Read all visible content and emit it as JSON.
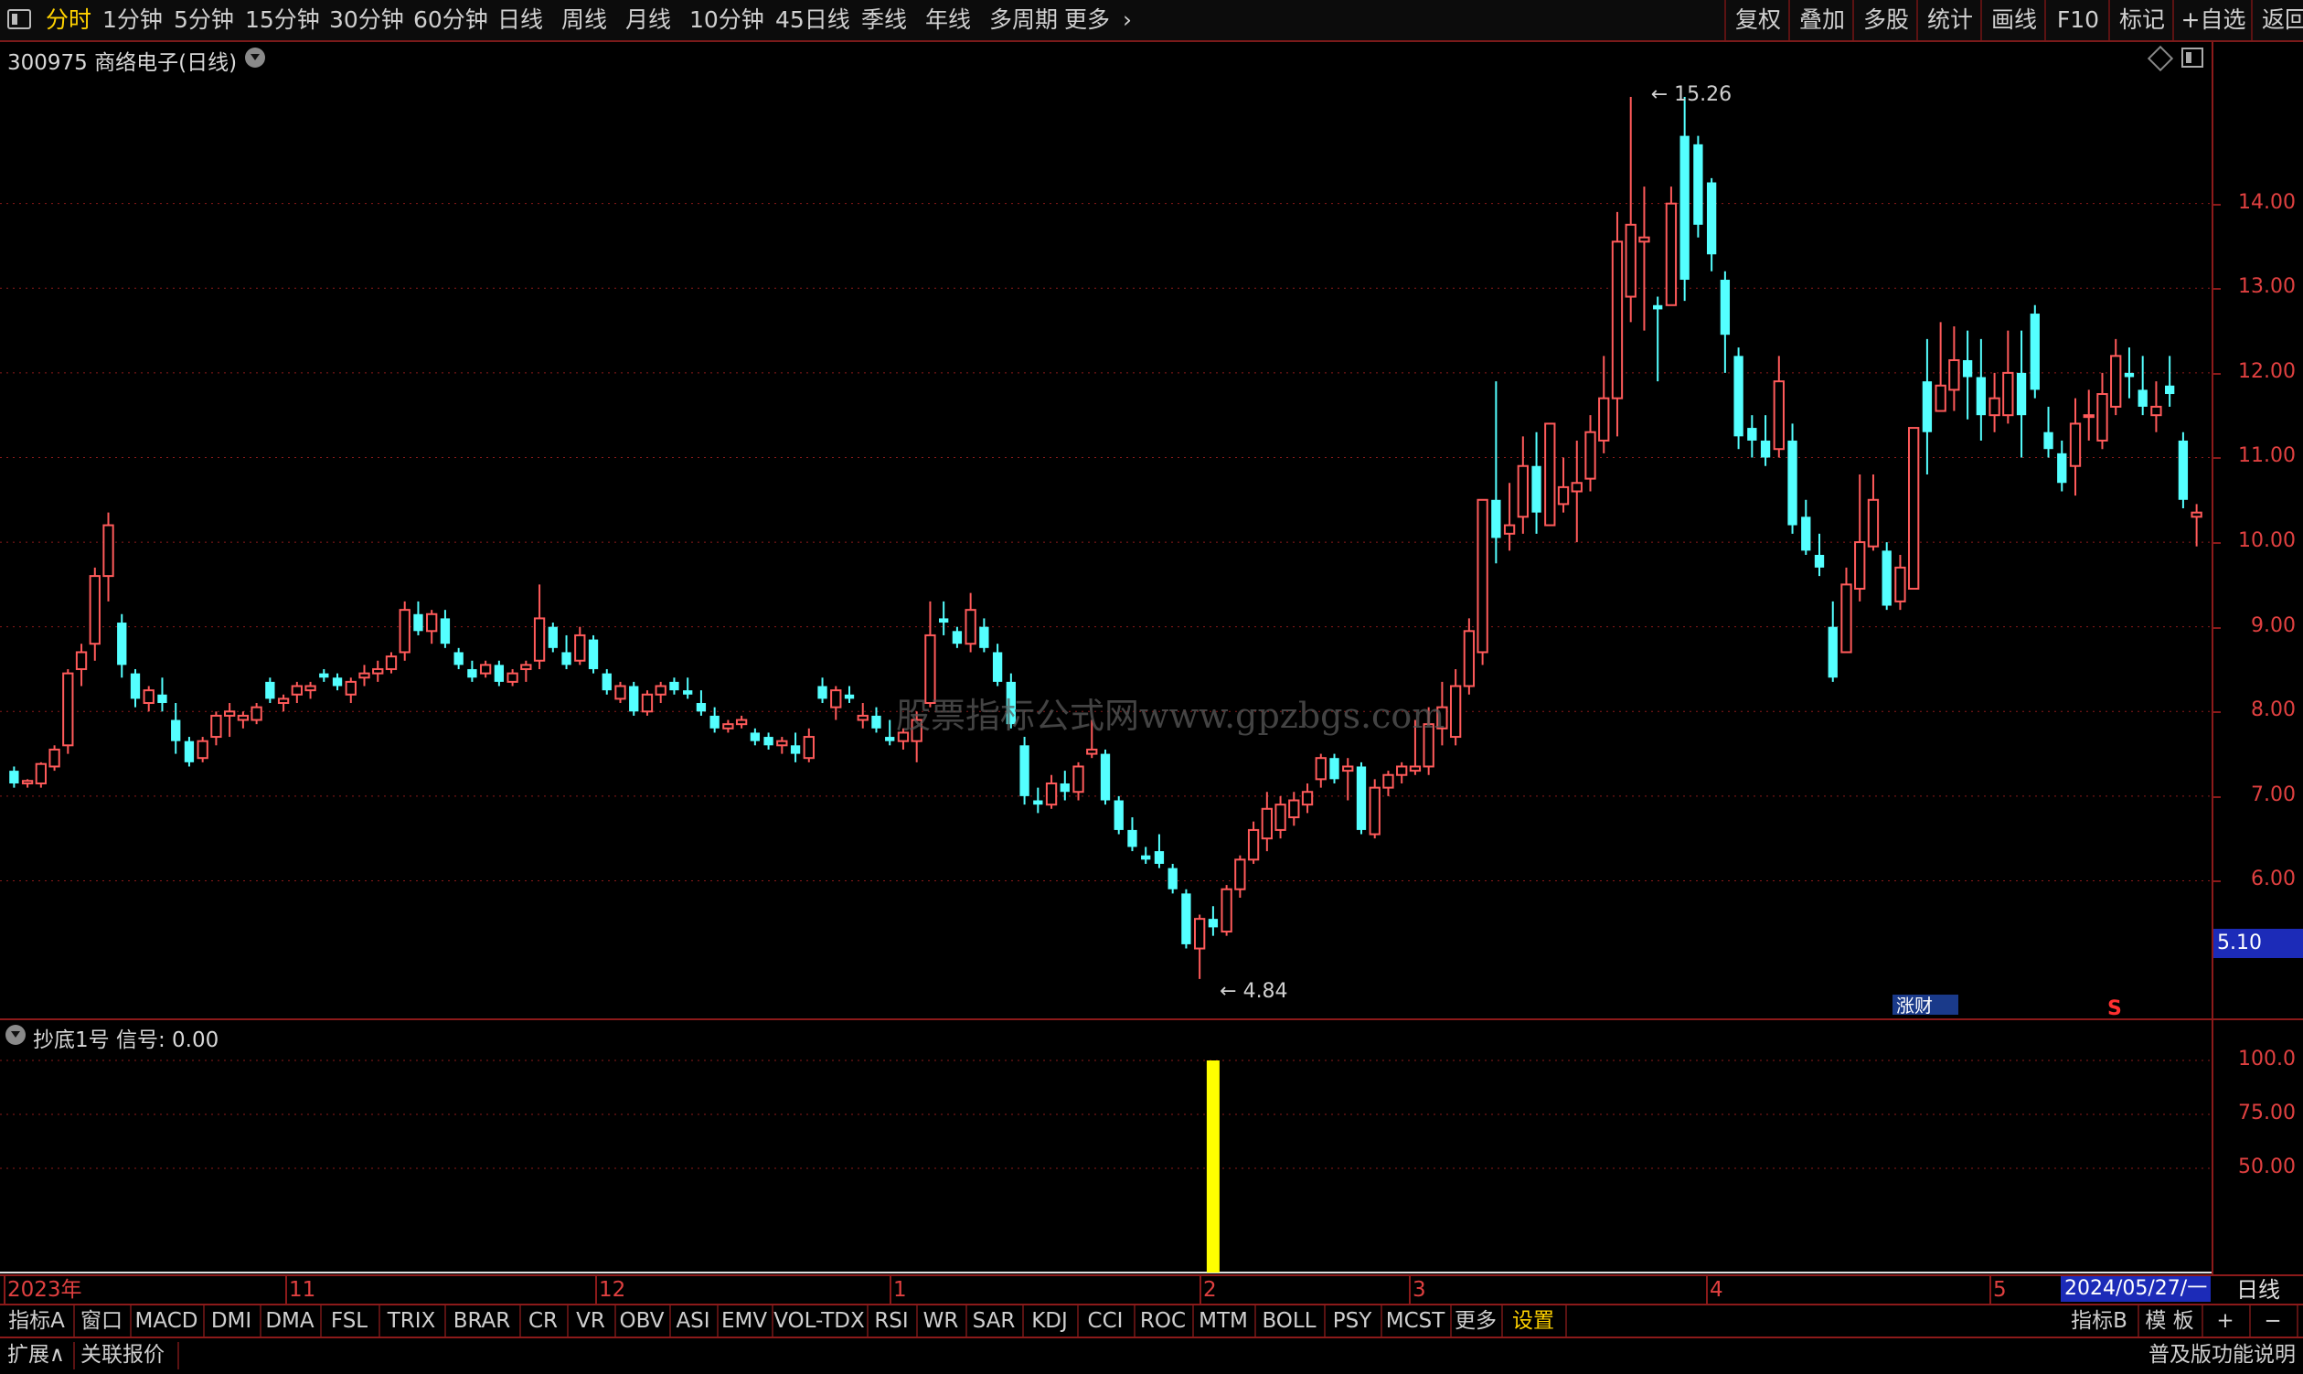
{
  "toolbar": {
    "periods": [
      "分时",
      "1分钟",
      "5分钟",
      "15分钟",
      "30分钟",
      "60分钟",
      "日线",
      "周线",
      "月线",
      "10分钟",
      "45日线",
      "季线",
      "年线",
      "多周期",
      "更多"
    ],
    "active_period": "分时",
    "right_buttons": [
      "复权",
      "叠加",
      "多股",
      "统计",
      "画线",
      "F10",
      "标记",
      "+自选",
      "返回"
    ]
  },
  "main_chart": {
    "title": "300975 商络电子(日线)",
    "high_label": "15.26",
    "low_label": "4.84",
    "last_price": "5.10",
    "y_ticks": [
      "14.00",
      "13.00",
      "12.00",
      "11.00",
      "10.00",
      "9.00",
      "8.00",
      "7.00",
      "6.00"
    ],
    "badge_text": "涨财",
    "s_marker": "S",
    "watermark": "股票指标公式网www.gpzbgs.com",
    "colors": {
      "up": "#ff5a5a",
      "down": "#54ffff",
      "grid": "#8b1a1a",
      "bg": "#000000"
    }
  },
  "indicator": {
    "title": "抄底1号  信号: 0.00",
    "y_ticks": [
      "100.0",
      "75.00",
      "50.00"
    ],
    "signal_color": "#ffff00"
  },
  "date_axis": {
    "labels": [
      "2023年",
      "11",
      "12",
      "1",
      "2",
      "3",
      "4",
      "5"
    ],
    "current_date": "2024/05/27/一",
    "right_label": "日线"
  },
  "indicator_tabs": [
    "指标A",
    "窗口",
    "MACD",
    "DMI",
    "DMA",
    "FSL",
    "TRIX",
    "BRAR",
    "CR",
    "VR",
    "OBV",
    "ASI",
    "EMV",
    "VOL-TDX",
    "RSI",
    "WR",
    "SAR",
    "KDJ",
    "CCI",
    "ROC",
    "MTM",
    "BOLL",
    "PSY",
    "MCST",
    "更多",
    "设置"
  ],
  "indicator_tabs_right": [
    "指标B",
    "模 板",
    "+",
    "−"
  ],
  "status": {
    "left": [
      "扩展∧",
      "关联报价"
    ],
    "right": "普及版功能说明"
  },
  "chart_data": {
    "type": "candlestick",
    "title": "300975 商络电子(日线)",
    "ylim": [
      4.84,
      15.26
    ],
    "series": [
      {
        "name": "K线",
        "ohlc": [
          [
            7.3,
            7.35,
            7.1,
            7.15
          ],
          [
            7.15,
            7.2,
            7.1,
            7.18
          ],
          [
            7.15,
            7.4,
            7.1,
            7.38
          ],
          [
            7.35,
            7.6,
            7.3,
            7.55
          ],
          [
            7.6,
            8.5,
            7.5,
            8.45
          ],
          [
            8.5,
            8.8,
            8.3,
            8.7
          ],
          [
            8.8,
            9.7,
            8.6,
            9.6
          ],
          [
            9.6,
            10.35,
            9.3,
            10.2
          ],
          [
            9.05,
            9.15,
            8.4,
            8.55
          ],
          [
            8.45,
            8.5,
            8.05,
            8.15
          ],
          [
            8.1,
            8.3,
            8.0,
            8.25
          ],
          [
            8.2,
            8.4,
            8.0,
            8.1
          ],
          [
            7.9,
            8.1,
            7.5,
            7.65
          ],
          [
            7.65,
            7.7,
            7.35,
            7.4
          ],
          [
            7.45,
            7.7,
            7.4,
            7.65
          ],
          [
            7.7,
            8.0,
            7.6,
            7.95
          ],
          [
            7.95,
            8.1,
            7.7,
            8.0
          ],
          [
            7.9,
            8.0,
            7.8,
            7.95
          ],
          [
            7.9,
            8.1,
            7.85,
            8.05
          ],
          [
            8.35,
            8.4,
            8.1,
            8.15
          ],
          [
            8.1,
            8.2,
            8.0,
            8.15
          ],
          [
            8.2,
            8.35,
            8.1,
            8.3
          ],
          [
            8.25,
            8.35,
            8.15,
            8.3
          ],
          [
            8.45,
            8.5,
            8.35,
            8.4
          ],
          [
            8.4,
            8.45,
            8.25,
            8.3
          ],
          [
            8.2,
            8.4,
            8.1,
            8.35
          ],
          [
            8.4,
            8.55,
            8.3,
            8.45
          ],
          [
            8.45,
            8.6,
            8.35,
            8.5
          ],
          [
            8.5,
            8.7,
            8.45,
            8.65
          ],
          [
            8.7,
            9.3,
            8.6,
            9.2
          ],
          [
            9.15,
            9.3,
            8.9,
            8.95
          ],
          [
            8.95,
            9.2,
            8.8,
            9.15
          ],
          [
            9.1,
            9.2,
            8.75,
            8.8
          ],
          [
            8.7,
            8.75,
            8.5,
            8.55
          ],
          [
            8.5,
            8.6,
            8.35,
            8.4
          ],
          [
            8.45,
            8.6,
            8.4,
            8.55
          ],
          [
            8.55,
            8.6,
            8.3,
            8.35
          ],
          [
            8.35,
            8.5,
            8.3,
            8.45
          ],
          [
            8.5,
            8.6,
            8.35,
            8.55
          ],
          [
            8.6,
            9.5,
            8.5,
            9.1
          ],
          [
            9.0,
            9.05,
            8.7,
            8.75
          ],
          [
            8.7,
            8.9,
            8.5,
            8.55
          ],
          [
            8.6,
            9.0,
            8.55,
            8.9
          ],
          [
            8.85,
            8.9,
            8.45,
            8.5
          ],
          [
            8.45,
            8.5,
            8.2,
            8.25
          ],
          [
            8.15,
            8.35,
            8.1,
            8.3
          ],
          [
            8.3,
            8.35,
            7.95,
            8.0
          ],
          [
            8.0,
            8.25,
            7.95,
            8.2
          ],
          [
            8.2,
            8.35,
            8.1,
            8.3
          ],
          [
            8.35,
            8.4,
            8.2,
            8.25
          ],
          [
            8.25,
            8.4,
            8.15,
            8.2
          ],
          [
            8.1,
            8.25,
            7.95,
            8.0
          ],
          [
            7.95,
            8.05,
            7.75,
            7.8
          ],
          [
            7.8,
            7.9,
            7.75,
            7.85
          ],
          [
            7.85,
            7.95,
            7.8,
            7.9
          ],
          [
            7.75,
            7.8,
            7.6,
            7.65
          ],
          [
            7.7,
            7.75,
            7.55,
            7.6
          ],
          [
            7.6,
            7.7,
            7.5,
            7.65
          ],
          [
            7.6,
            7.75,
            7.4,
            7.5
          ],
          [
            7.45,
            7.8,
            7.4,
            7.7
          ],
          [
            8.3,
            8.4,
            8.1,
            8.15
          ],
          [
            8.05,
            8.3,
            7.9,
            8.25
          ],
          [
            8.2,
            8.3,
            8.1,
            8.15
          ],
          [
            7.9,
            8.1,
            7.8,
            7.95
          ],
          [
            7.95,
            8.05,
            7.75,
            7.8
          ],
          [
            7.7,
            7.9,
            7.6,
            7.65
          ],
          [
            7.65,
            7.8,
            7.55,
            7.75
          ],
          [
            7.65,
            8.0,
            7.4,
            7.9
          ],
          [
            8.1,
            9.3,
            8.05,
            8.9
          ],
          [
            9.1,
            9.3,
            8.9,
            9.05
          ],
          [
            8.95,
            9.0,
            8.75,
            8.8
          ],
          [
            8.8,
            9.4,
            8.7,
            9.2
          ],
          [
            9.0,
            9.1,
            8.7,
            8.75
          ],
          [
            8.7,
            8.8,
            8.3,
            8.35
          ],
          [
            8.35,
            8.45,
            7.8,
            7.85
          ],
          [
            7.6,
            7.7,
            6.9,
            7.0
          ],
          [
            6.95,
            7.1,
            6.8,
            6.9
          ],
          [
            6.9,
            7.25,
            6.85,
            7.15
          ],
          [
            7.15,
            7.3,
            6.95,
            7.05
          ],
          [
            7.05,
            7.4,
            6.95,
            7.35
          ],
          [
            7.5,
            7.9,
            7.45,
            7.55
          ],
          [
            7.5,
            7.55,
            6.9,
            6.95
          ],
          [
            6.95,
            7.0,
            6.55,
            6.6
          ],
          [
            6.6,
            6.75,
            6.35,
            6.4
          ],
          [
            6.3,
            6.4,
            6.2,
            6.25
          ],
          [
            6.35,
            6.55,
            6.15,
            6.2
          ],
          [
            6.15,
            6.2,
            5.85,
            5.9
          ],
          [
            5.85,
            5.9,
            5.2,
            5.25
          ],
          [
            5.2,
            5.6,
            4.84,
            5.55
          ],
          [
            5.55,
            5.7,
            5.35,
            5.45
          ],
          [
            5.4,
            5.95,
            5.35,
            5.9
          ],
          [
            5.9,
            6.3,
            5.8,
            6.25
          ],
          [
            6.25,
            6.7,
            6.2,
            6.6
          ],
          [
            6.5,
            7.05,
            6.35,
            6.85
          ],
          [
            6.6,
            7.0,
            6.5,
            6.9
          ],
          [
            6.75,
            7.05,
            6.65,
            6.95
          ],
          [
            6.9,
            7.15,
            6.8,
            7.05
          ],
          [
            7.2,
            7.5,
            7.1,
            7.45
          ],
          [
            7.45,
            7.5,
            7.15,
            7.2
          ],
          [
            7.3,
            7.45,
            6.95,
            7.35
          ],
          [
            7.35,
            7.4,
            6.55,
            6.6
          ],
          [
            6.55,
            7.2,
            6.5,
            7.1
          ],
          [
            7.1,
            7.3,
            7.0,
            7.25
          ],
          [
            7.25,
            7.4,
            7.15,
            7.35
          ],
          [
            7.3,
            7.9,
            7.25,
            7.35
          ],
          [
            7.35,
            8.05,
            7.25,
            7.85
          ],
          [
            7.8,
            8.35,
            7.6,
            8.05
          ],
          [
            7.7,
            8.5,
            7.6,
            8.3
          ],
          [
            8.3,
            9.1,
            8.2,
            8.95
          ],
          [
            8.7,
            10.5,
            8.55,
            10.5
          ],
          [
            10.5,
            11.9,
            9.75,
            10.05
          ],
          [
            10.1,
            10.7,
            9.9,
            10.2
          ],
          [
            10.3,
            11.25,
            10.1,
            10.9
          ],
          [
            10.9,
            11.3,
            10.1,
            10.35
          ],
          [
            10.2,
            11.4,
            10.3,
            11.4
          ],
          [
            10.45,
            11.0,
            10.35,
            10.65
          ],
          [
            10.6,
            11.2,
            10.0,
            10.7
          ],
          [
            10.75,
            11.5,
            10.6,
            11.3
          ],
          [
            11.2,
            12.2,
            11.05,
            11.7
          ],
          [
            11.7,
            13.9,
            11.25,
            13.55
          ],
          [
            12.9,
            15.26,
            12.6,
            13.75
          ],
          [
            13.55,
            14.2,
            12.5,
            13.6
          ],
          [
            12.8,
            12.9,
            11.9,
            12.75
          ],
          [
            12.8,
            14.2,
            12.9,
            14.0
          ],
          [
            14.8,
            15.26,
            12.85,
            13.1
          ],
          [
            14.7,
            14.8,
            13.6,
            13.75
          ],
          [
            14.25,
            14.3,
            13.2,
            13.4
          ],
          [
            13.1,
            13.2,
            12.0,
            12.45
          ],
          [
            12.2,
            12.3,
            11.1,
            11.25
          ],
          [
            11.35,
            11.5,
            11.0,
            11.2
          ],
          [
            11.2,
            11.5,
            10.9,
            11.0
          ],
          [
            11.1,
            12.2,
            11.0,
            11.9
          ],
          [
            11.2,
            11.4,
            10.1,
            10.2
          ],
          [
            10.3,
            10.5,
            9.85,
            9.9
          ],
          [
            9.85,
            10.1,
            9.6,
            9.7
          ],
          [
            9.0,
            9.3,
            8.35,
            8.4
          ],
          [
            8.7,
            9.7,
            8.7,
            9.5
          ],
          [
            9.45,
            10.8,
            9.3,
            10.0
          ],
          [
            9.95,
            10.8,
            9.9,
            10.5
          ],
          [
            9.9,
            10.0,
            9.2,
            9.25
          ],
          [
            9.3,
            9.85,
            9.2,
            9.7
          ],
          [
            9.45,
            11.2,
            9.45,
            11.35
          ],
          [
            11.9,
            12.4,
            10.8,
            11.3
          ],
          [
            11.55,
            12.6,
            11.6,
            11.85
          ],
          [
            11.8,
            12.55,
            11.55,
            12.15
          ],
          [
            12.15,
            12.5,
            11.45,
            11.95
          ],
          [
            11.95,
            12.4,
            11.2,
            11.5
          ],
          [
            11.5,
            12.0,
            11.3,
            11.7
          ],
          [
            11.5,
            12.5,
            11.4,
            12.0
          ],
          [
            12.0,
            12.5,
            11.0,
            11.5
          ],
          [
            12.7,
            12.8,
            11.7,
            11.8
          ],
          [
            11.3,
            11.6,
            11.0,
            11.1
          ],
          [
            11.05,
            11.2,
            10.6,
            10.7
          ],
          [
            10.9,
            11.7,
            10.55,
            11.4
          ],
          [
            11.5,
            11.8,
            11.2,
            11.5
          ],
          [
            11.2,
            12.0,
            11.1,
            11.75
          ],
          [
            11.6,
            12.4,
            11.5,
            12.2
          ],
          [
            12.0,
            12.3,
            11.7,
            11.95
          ],
          [
            11.8,
            12.2,
            11.5,
            11.6
          ],
          [
            11.5,
            11.9,
            11.3,
            11.6
          ],
          [
            11.85,
            12.2,
            11.6,
            11.75
          ],
          [
            11.2,
            11.3,
            10.4,
            10.5
          ],
          [
            10.3,
            10.45,
            9.95,
            10.35
          ]
        ]
      }
    ],
    "indicator_series": {
      "name": "抄底1号",
      "signal_index": 89,
      "signal_value": 100
    }
  }
}
